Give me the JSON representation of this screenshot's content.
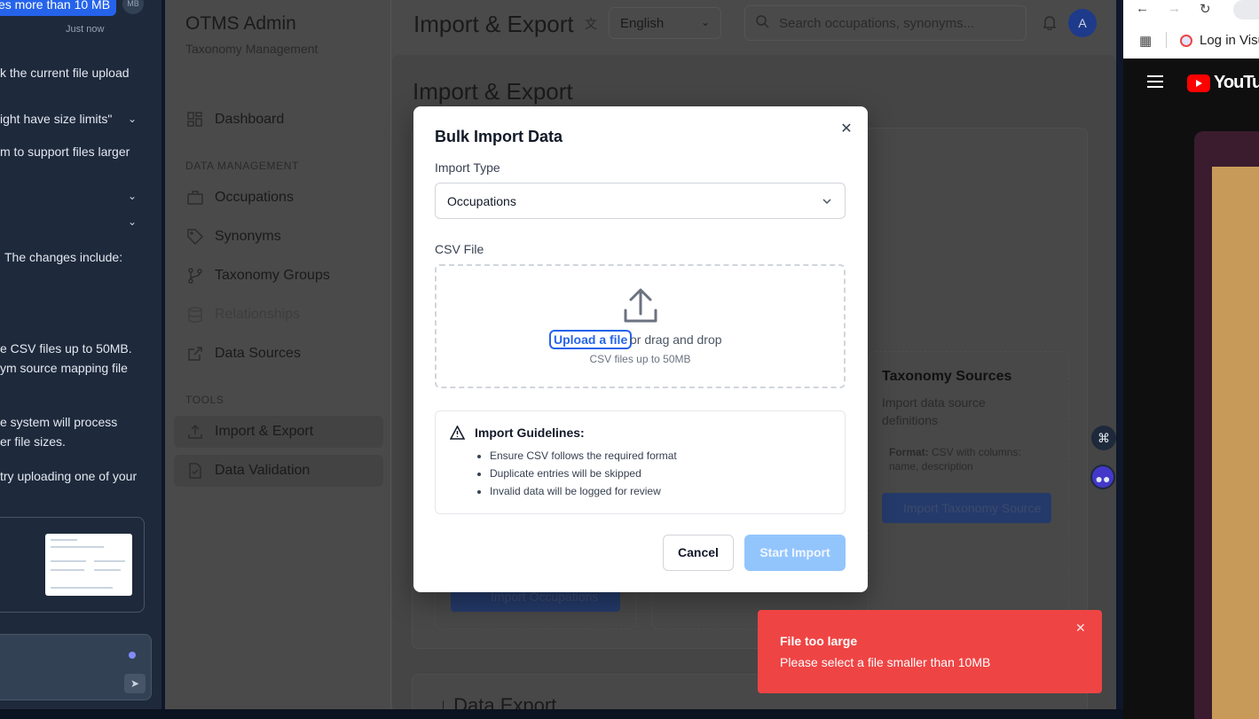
{
  "chat": {
    "bubble_text": "es more than 10 MB",
    "avatar_initials": "MB",
    "timestamp": "Just now",
    "line_a": "k the current file upload",
    "line_b": "ight have size limits\"",
    "line_c": "m to support files larger",
    "line_d": "The changes include:",
    "line_e": "e CSV files up to 50MB.",
    "line_f": "ym source mapping file",
    "line_g": "e system will process",
    "line_h": "er file sizes.",
    "line_i": "try uploading one of your"
  },
  "sidebar": {
    "title": "OTMS Admin",
    "subtitle": "Taxonomy Management",
    "dashboard": "Dashboard",
    "section_data": "DATA MANAGEMENT",
    "items": [
      "Occupations",
      "Synonyms",
      "Taxonomy Groups",
      "Relationships",
      "Data Sources"
    ],
    "section_tools": "TOOLS",
    "tools": [
      "Import & Export",
      "Data Validation"
    ]
  },
  "topbar": {
    "title": "Import & Export",
    "language": "English",
    "search_placeholder": "Search occupations, synonyms...",
    "avatar": "A"
  },
  "main": {
    "heading": "Import & Export",
    "taxonomy_title": "Taxonomy Sources",
    "taxonomy_desc": "Import data source definitions",
    "format_label": "Format:",
    "format_text": "CSV with columns: name, description",
    "taxonomy_button": "Import Taxonomy Source",
    "occupations_button": "Import Occupations",
    "export_heading": "Data Export"
  },
  "modal": {
    "title": "Bulk Import Data",
    "import_type_label": "Import Type",
    "import_type_value": "Occupations",
    "csv_label": "CSV File",
    "upload_link": "Upload a file",
    "drag_text": "or drag and drop",
    "hint": "CSV files up to 50MB",
    "guidelines_title": "Import Guidelines:",
    "guidelines": [
      "Ensure CSV follows the required format",
      "Duplicate entries will be skipped",
      "Invalid data will be logged for review"
    ],
    "cancel": "Cancel",
    "start": "Start Import"
  },
  "toast": {
    "title": "File too large",
    "message": "Please select a file smaller than 10MB"
  },
  "browser": {
    "bookmark": "Log in Visu",
    "yt_text": "YouTub"
  }
}
